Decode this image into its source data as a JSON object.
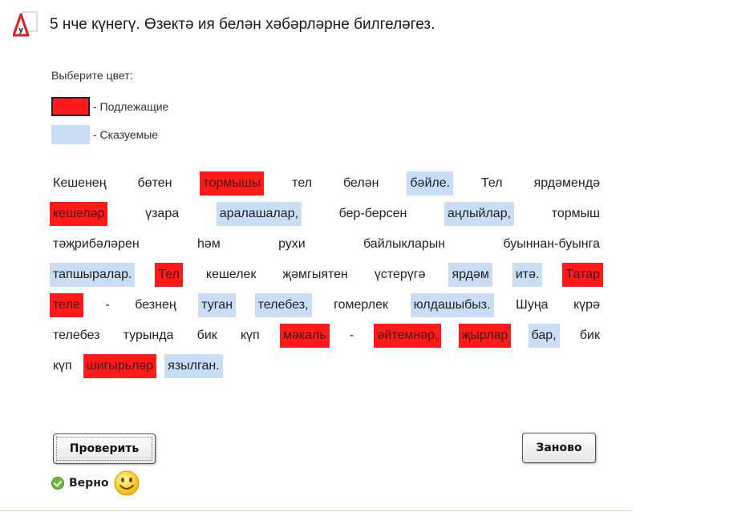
{
  "header": {
    "title": "5 нче күнегү. Өзектә ия белән хәбәрләрне билгеләгез.",
    "icon": "warning-triangle-icon"
  },
  "prompt": "Выберите цвет:",
  "legend": [
    {
      "label": "- Подлежащие",
      "color": "#ff1a1a"
    },
    {
      "label": "- Сказуемые",
      "color": "#c9ddf7"
    }
  ],
  "text_lines": [
    [
      {
        "text": "Кешенең",
        "role": "none"
      },
      {
        "text": "бөтен",
        "role": "none"
      },
      {
        "text": "тормышы",
        "role": "subject"
      },
      {
        "text": "тел",
        "role": "none"
      },
      {
        "text": "белән",
        "role": "none"
      },
      {
        "text": "бәйле.",
        "role": "predicate"
      },
      {
        "text": "Тел",
        "role": "none"
      },
      {
        "text": "ярдәмендә",
        "role": "none"
      }
    ],
    [
      {
        "text": "кешеләр",
        "role": "subject"
      },
      {
        "text": "үзара",
        "role": "none"
      },
      {
        "text": "аралашалар,",
        "role": "predicate"
      },
      {
        "text": "бер-берсен",
        "role": "none"
      },
      {
        "text": "аңлыйлар,",
        "role": "predicate"
      },
      {
        "text": "тормыш",
        "role": "none"
      }
    ],
    [
      {
        "text": "тәҗрибәләрен",
        "role": "none"
      },
      {
        "text": "һәм",
        "role": "none"
      },
      {
        "text": "рухи",
        "role": "none"
      },
      {
        "text": "байлыкларын",
        "role": "none"
      },
      {
        "text": "буыннан-буынга",
        "role": "none"
      }
    ],
    [
      {
        "text": "тапшыралар.",
        "role": "predicate"
      },
      {
        "text": "Тел",
        "role": "subject"
      },
      {
        "text": "кешелек",
        "role": "none"
      },
      {
        "text": "җәмгыятен",
        "role": "none"
      },
      {
        "text": "үстерүгә",
        "role": "none"
      },
      {
        "text": "ярдәм",
        "role": "predicate"
      },
      {
        "text": "итә.",
        "role": "predicate"
      },
      {
        "text": "Татар",
        "role": "subject"
      }
    ],
    [
      {
        "text": "теле",
        "role": "subject"
      },
      {
        "text": "-",
        "role": "none"
      },
      {
        "text": "безнең",
        "role": "none"
      },
      {
        "text": "туган",
        "role": "predicate"
      },
      {
        "text": "телебез,",
        "role": "predicate"
      },
      {
        "text": "гомерлек",
        "role": "none"
      },
      {
        "text": "юлдашыбыз.",
        "role": "predicate"
      },
      {
        "text": "Шуңа",
        "role": "none"
      },
      {
        "text": "күрә",
        "role": "none"
      }
    ],
    [
      {
        "text": "телебез",
        "role": "none"
      },
      {
        "text": "турында",
        "role": "none"
      },
      {
        "text": "бик",
        "role": "none"
      },
      {
        "text": "күп",
        "role": "none"
      },
      {
        "text": "мәкаль",
        "role": "subject"
      },
      {
        "text": "-",
        "role": "none"
      },
      {
        "text": "әйтемнәр,",
        "role": "subject"
      },
      {
        "text": "җырлар",
        "role": "subject"
      },
      {
        "text": "бар,",
        "role": "predicate"
      },
      {
        "text": "бик",
        "role": "none"
      }
    ],
    [
      {
        "text": "күп",
        "role": "none"
      },
      {
        "text": "шигырьләр",
        "role": "subject"
      },
      {
        "text": "язылган.",
        "role": "predicate"
      }
    ]
  ],
  "buttons": {
    "check": "Проверить",
    "reset": "Заново"
  },
  "result": {
    "label": "Верно",
    "status_icon": "check-circle-icon",
    "emoji_icon": "smiley-face-icon"
  }
}
